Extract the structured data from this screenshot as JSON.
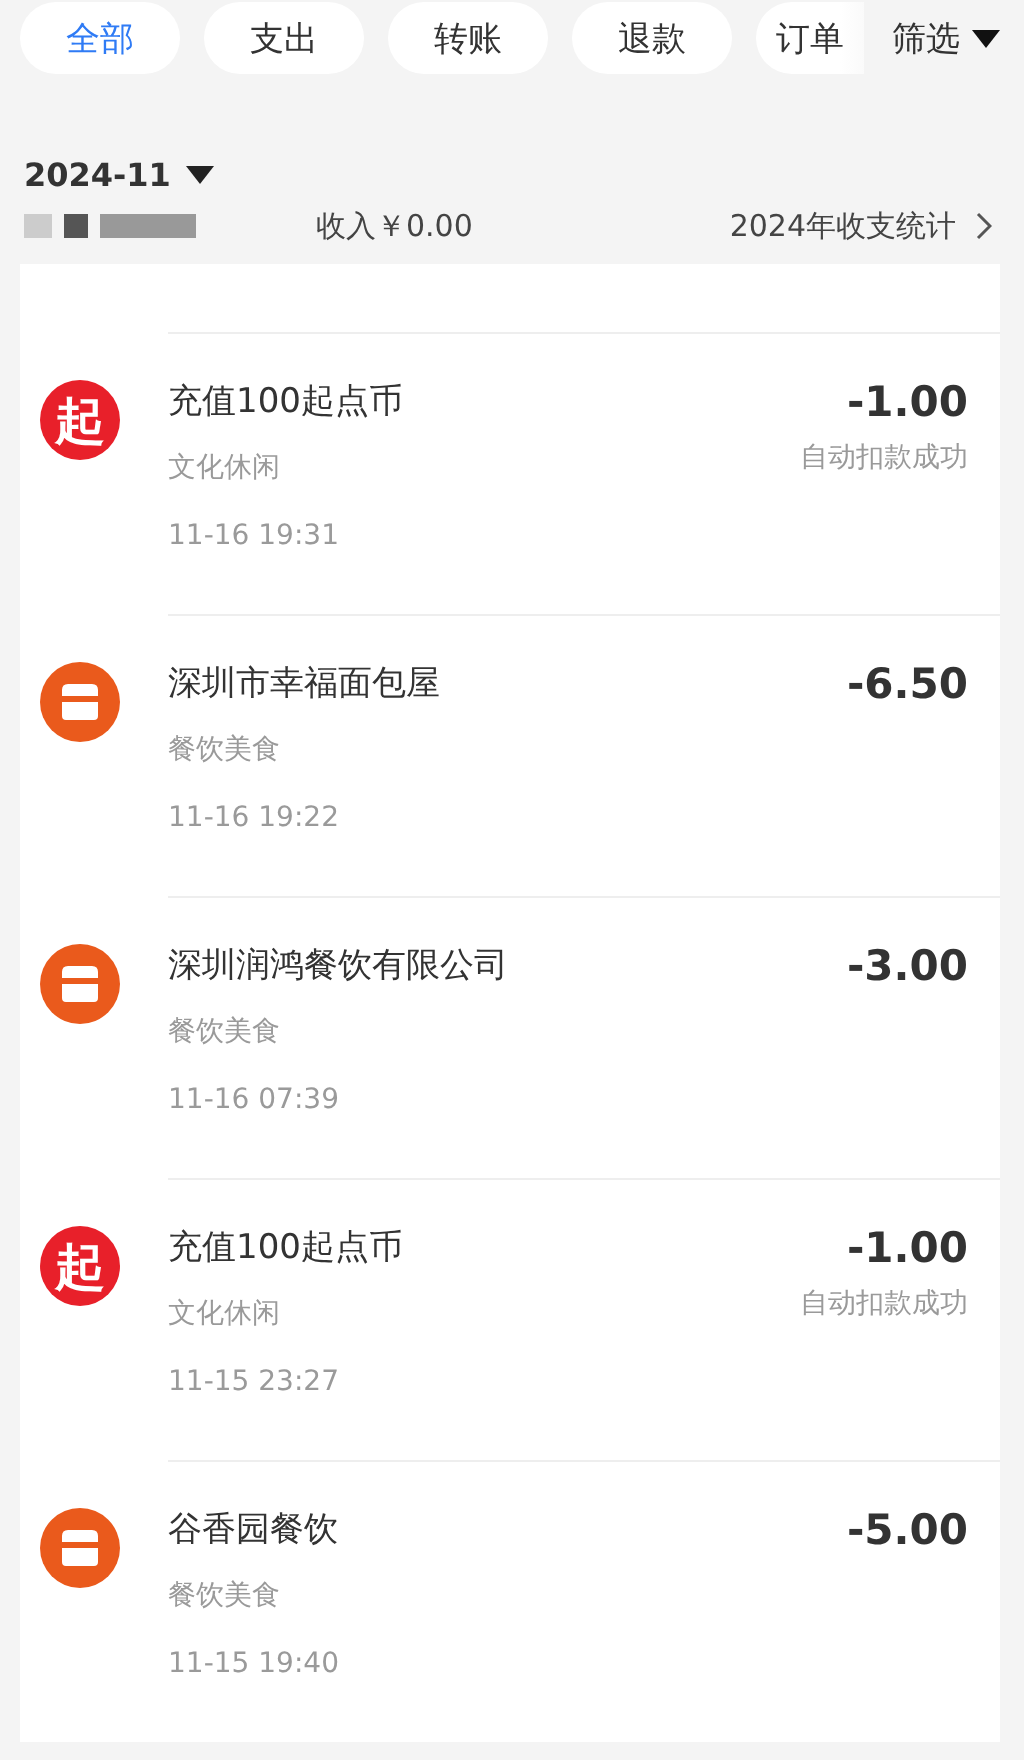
{
  "tabs": [
    {
      "label": "全部",
      "selected": true
    },
    {
      "label": "支出",
      "selected": false
    },
    {
      "label": "转账",
      "selected": false
    },
    {
      "label": "退款",
      "selected": false
    },
    {
      "label": "订单",
      "selected": false
    }
  ],
  "filter": {
    "label": "筛选"
  },
  "month": {
    "label": "2024-11",
    "income": "收入￥0.00",
    "stats_link": "2024年收支统计"
  },
  "bills": [
    {
      "icon": {
        "kind": "logo",
        "text": "起"
      },
      "title": "充值100起点币",
      "category": "文化休闲",
      "time": "11-16 19:31",
      "amount": "-1.00",
      "status": "自动扣款成功"
    },
    {
      "icon": {
        "kind": "shop"
      },
      "title": "深圳市幸福面包屋",
      "category": "餐饮美食",
      "time": "11-16 19:22",
      "amount": "-6.50"
    },
    {
      "icon": {
        "kind": "shop"
      },
      "title": "深圳润鸿餐饮有限公司",
      "category": "餐饮美食",
      "time": "11-16 07:39",
      "amount": "-3.00"
    },
    {
      "icon": {
        "kind": "logo",
        "text": "起"
      },
      "title": "充值100起点币",
      "category": "文化休闲",
      "time": "11-15 23:27",
      "amount": "-1.00",
      "status": "自动扣款成功"
    },
    {
      "icon": {
        "kind": "shop"
      },
      "title": "谷香园餐饮",
      "category": "餐饮美食",
      "time": "11-15 19:40",
      "amount": "-5.00"
    }
  ]
}
